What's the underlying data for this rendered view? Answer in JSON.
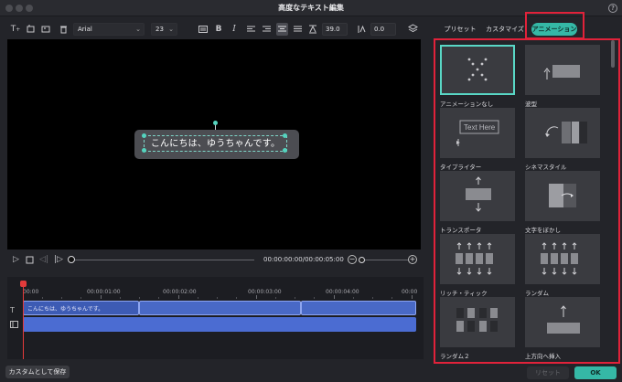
{
  "window": {
    "title": "高度なテキスト編集",
    "help_icon": "?"
  },
  "toolbar": {
    "font": "Arial",
    "size": "23",
    "spacing": "39.0",
    "line_spacing": "0.0",
    "bold": "B",
    "italic": "I"
  },
  "preview": {
    "text": "こんにちは、ゆうちゃんです。"
  },
  "playback": {
    "timecode": "00:00:00:00/00:00:05:00"
  },
  "timeline": {
    "ruler": [
      "00:00",
      "00:00:01:00",
      "00:00:02:00",
      "00:00:03:00",
      "00:00:04:00",
      "00:00"
    ],
    "clip_label": "こんにちは、ゆうちゃんです。"
  },
  "tabs": [
    {
      "label": "プリセット",
      "active": false
    },
    {
      "label": "カスタマイズ",
      "active": false
    },
    {
      "label": "アニメーション",
      "active": true
    }
  ],
  "animations": [
    {
      "label": "アニメーションなし",
      "icon": "no-animation-icon",
      "selected": true
    },
    {
      "label": "波型",
      "icon": "wave-icon",
      "selected": false
    },
    {
      "label": "タイプライター",
      "icon": "typewriter-icon",
      "selected": false,
      "sample": "Text Here"
    },
    {
      "label": "シネマスタイル",
      "icon": "cinema-style-icon",
      "selected": false
    },
    {
      "label": "トランスポータ",
      "icon": "transporter-icon",
      "selected": false
    },
    {
      "label": "文字をぼかし",
      "icon": "blur-text-icon",
      "selected": false
    },
    {
      "label": "リッチ・ティック",
      "icon": "rich-tick-icon",
      "selected": false
    },
    {
      "label": "ランダム",
      "icon": "random-icon",
      "selected": false
    },
    {
      "label": "ランダム２",
      "icon": "random2-icon",
      "selected": false
    },
    {
      "label": "上方向へ挿入",
      "icon": "insert-up-icon",
      "selected": false
    }
  ],
  "footer": {
    "save_custom": "カスタムとして保存",
    "reset": "リセット",
    "ok": "OK"
  },
  "colors": {
    "accent": "#35b8a6",
    "highlight": "#e1223a",
    "clip": "#4969c6"
  }
}
